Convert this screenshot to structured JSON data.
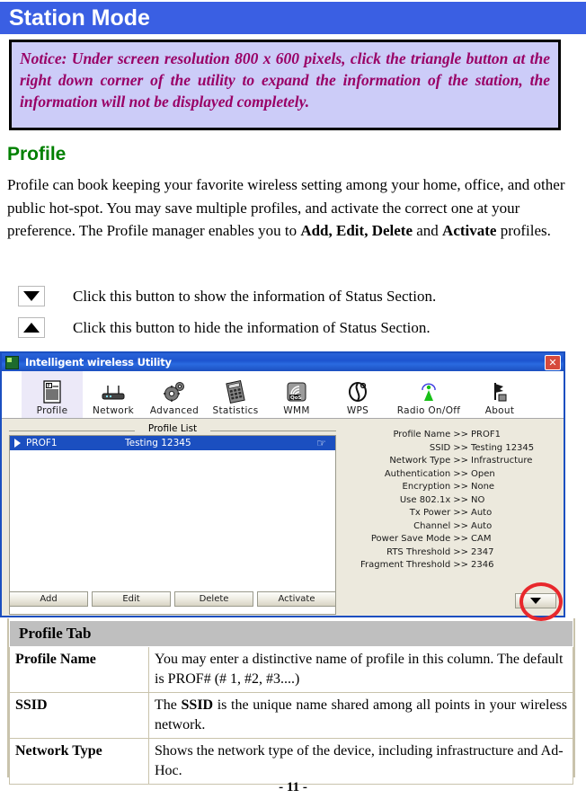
{
  "page": {
    "title": "Station Mode",
    "footer": "- 11 -",
    "header_color": "#3a5fe3"
  },
  "notice": {
    "text": "Notice: Under screen resolution 800 x 600 pixels, click the triangle button at the right down corner of the utility to expand the information of the station, the information will not be displayed completely.",
    "bg_color": "#ccccf8",
    "text_color": "#990066"
  },
  "profile_section": {
    "heading": "Profile",
    "heading_color": "#008000",
    "paragraph_part1": "Profile can book keeping your favorite wireless setting among your home, office, and other public hot-spot. You may save multiple profiles, and activate the correct one at your preference. The Profile manager enables you to ",
    "paragraph_bold1": "Add, Edit, Delete",
    "paragraph_part2": " and ",
    "paragraph_bold2": "Activate",
    "paragraph_part3": " profiles."
  },
  "legend": [
    {
      "icon": "triangle-down-icon",
      "text": "Click this button to show the information of Status Section."
    },
    {
      "icon": "triangle-up-icon",
      "text": "Click this button to hide the information of Status Section."
    }
  ],
  "app": {
    "window_title": "Intelligent wireless Utility",
    "close_label": "✕",
    "toolbar": [
      {
        "label": "Profile",
        "icon": "profile-icon",
        "active": true
      },
      {
        "label": "Network",
        "icon": "network-icon",
        "active": false
      },
      {
        "label": "Advanced",
        "icon": "advanced-gear-icon",
        "active": false
      },
      {
        "label": "Statistics",
        "icon": "statistics-icon",
        "active": false
      },
      {
        "label": "WMM",
        "icon": "wmm-qos-icon",
        "active": false
      },
      {
        "label": "WPS",
        "icon": "wps-icon",
        "active": false
      },
      {
        "label": "Radio On/Off",
        "icon": "radio-onoff-icon",
        "active": false
      },
      {
        "label": "About",
        "icon": "about-icon",
        "active": false
      }
    ],
    "profile_list": {
      "group_label": "Profile List",
      "rows": [
        {
          "name": "PROF1",
          "ssid": "Testing 12345",
          "selected": true
        }
      ]
    },
    "details": [
      {
        "key": "Profile Name",
        "sep": ">>",
        "value": "PROF1"
      },
      {
        "key": "SSID",
        "sep": ">>",
        "value": "Testing 12345"
      },
      {
        "key": "Network Type",
        "sep": ">>",
        "value": "Infrastructure"
      },
      {
        "key": "Authentication",
        "sep": ">>",
        "value": "Open"
      },
      {
        "key": "Encryption",
        "sep": ">>",
        "value": "None"
      },
      {
        "key": "Use 802.1x",
        "sep": ">>",
        "value": "NO"
      },
      {
        "key": "Tx Power",
        "sep": ">>",
        "value": "Auto"
      },
      {
        "key": "Channel",
        "sep": ">>",
        "value": "Auto"
      },
      {
        "key": "Power Save Mode",
        "sep": ">>",
        "value": "CAM"
      },
      {
        "key": "RTS Threshold",
        "sep": ">>",
        "value": "2347"
      },
      {
        "key": "Fragment Threshold",
        "sep": ">>",
        "value": "2346"
      }
    ],
    "buttons": [
      {
        "label": "Add"
      },
      {
        "label": "Edit"
      },
      {
        "label": "Delete"
      },
      {
        "label": "Activate"
      }
    ],
    "expand_button": {
      "icon": "triangle-down-icon",
      "highlight_color": "#e8282c"
    }
  },
  "ref_table": {
    "header": "Profile Tab",
    "rows": [
      {
        "key": "Profile Name",
        "value": "You may enter a distinctive name of profile in this column. The default is PROF# (# 1, #2, #3....)"
      },
      {
        "key": "SSID",
        "value_pre": "The ",
        "value_bold": "SSID",
        "value_post": " is the unique name shared among all points in your wireless network."
      },
      {
        "key": "Network Type",
        "value": "Shows the network type of the device, including infrastructure and Ad-Hoc."
      }
    ]
  }
}
